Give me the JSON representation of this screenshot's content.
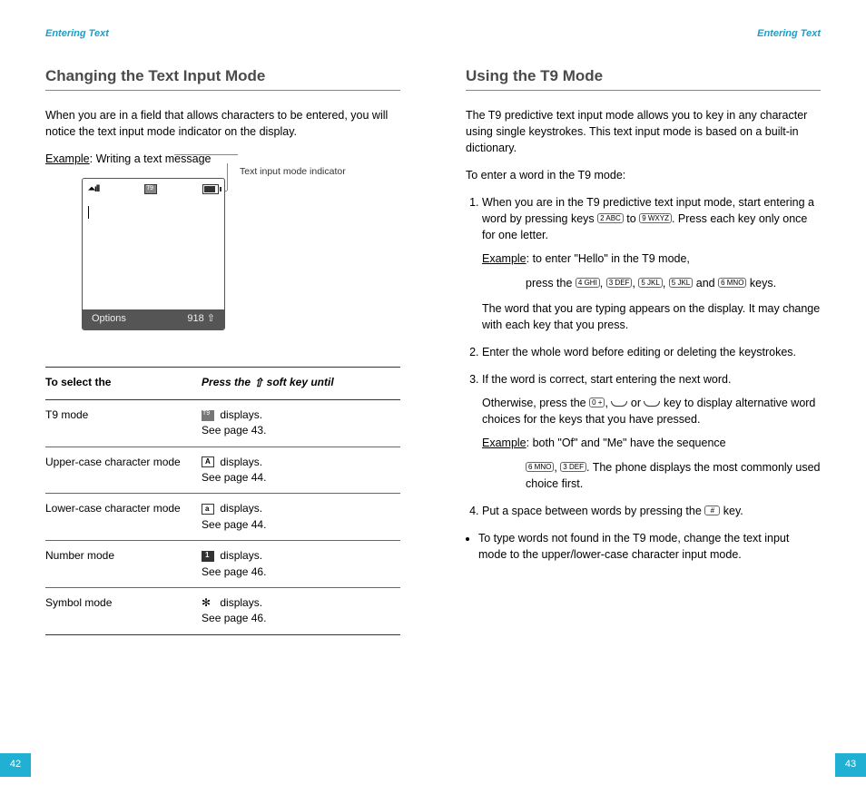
{
  "left": {
    "running_head": "Entering Text",
    "heading": "Changing the Text Input Mode",
    "intro": "When you are in a field that allows characters to be entered, you will notice the text input mode indicator on the display.",
    "example_label": "Example",
    "example_text": ": Writing a text message",
    "callout": "Text input mode indicator",
    "phone": {
      "options_label": "Options",
      "counter": "918"
    },
    "table": {
      "col1": "To select the",
      "col2_a": "Press the ",
      "col2_b": " soft key until",
      "rows": [
        {
          "mode": "T9 mode",
          "displays": " displays.",
          "see": "See page 43."
        },
        {
          "mode": "Upper-case character mode",
          "displays": " displays.",
          "see": "See page 44."
        },
        {
          "mode": "Lower-case character mode",
          "displays": " displays.",
          "see": "See page 44."
        },
        {
          "mode": "Number mode",
          "displays": " displays.",
          "see": "See page 46."
        },
        {
          "mode": "Symbol mode",
          "displays": " displays.",
          "see": "See page 46."
        }
      ]
    },
    "page_number": "42"
  },
  "right": {
    "running_head": "Entering Text",
    "heading": "Using the T9 Mode",
    "intro": "The T9 predictive text input mode allows you to key in any character using single keystrokes. This text input mode is based on a built-in dictionary.",
    "lead": "To enter a word in the T9 mode:",
    "step1a": "When you are in the T9 predictive text input mode, start entering a word by pressing keys ",
    "step1b": " to ",
    "step1c": ". Press each key only once for one letter.",
    "step1_example_label": "Example",
    "step1_example_a": ": to enter \"Hello\" in the T9 mode,",
    "step1_example_b": "press the ",
    "step1_example_c": " and ",
    "step1_example_d": " keys.",
    "step1_tail": "The word that you are typing appears on the display. It may change with each key that you press.",
    "step2": "Enter the whole word before editing or deleting the keystrokes.",
    "step3a": "If the word is correct, start entering the next word.",
    "step3b_a": "Otherwise, press the ",
    "step3b_b": " or ",
    "step3b_c": " key to display alternative word choices for the keys that you have pressed.",
    "step3_example_label": "Example",
    "step3_example_a": ": both \"Of\" and \"Me\" have the sequence ",
    "step3_example_b": ". The phone displays the most commonly used choice first.",
    "step4a": "Put a space between words by pressing the ",
    "step4b": " key.",
    "bullet": "To type words not found in the T9 mode, change the text input mode to the upper/lower-case character input mode.",
    "keys": {
      "k2": "2 ABC",
      "k3": "3 DEF",
      "k4": "4 GHI",
      "k5": "5 JKL",
      "k6": "6 MNO",
      "k9": "9 WXYZ",
      "k0": "0 +",
      "hash": "#"
    },
    "page_number": "43"
  }
}
